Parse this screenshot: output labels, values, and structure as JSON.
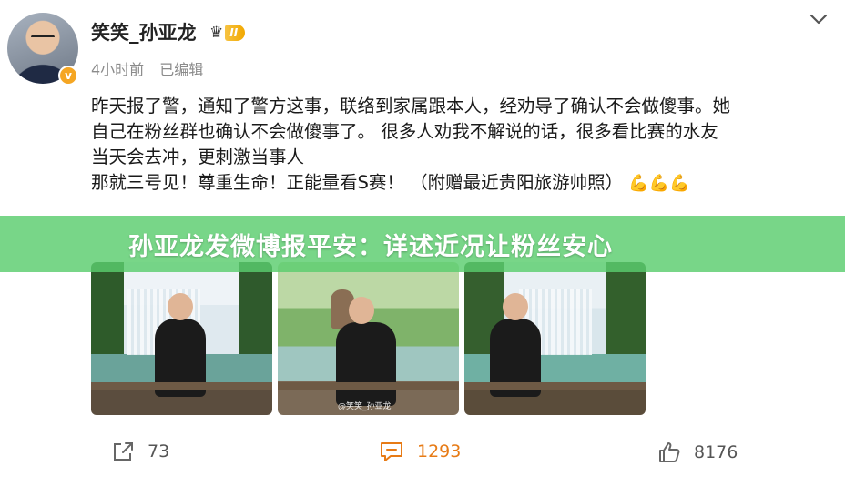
{
  "user": {
    "name": "笑笑_孙亚龙",
    "level_badge": "II",
    "verified_mark": "v"
  },
  "meta": {
    "time": "4小时前",
    "edited": "已编辑"
  },
  "post": {
    "lines": [
      "昨天报了警，通知了警方这事，联络到家属跟本人，经劝导了确认不会做傻事。她",
      "自己在粉丝群也确认不会做傻事了。 很多人劝我不解说的话，很多看比赛的水友",
      "当天会去冲，更刺激当事人",
      "那就三号见！尊重生命！正能量看S赛！  （附赠最近贵阳旅游帅照）"
    ],
    "emojis": "💪💪💪"
  },
  "photos": {
    "watermark": "@笑笑_孙亚龙"
  },
  "banner": {
    "title": "孙亚龙发微博报平安：详述近况让粉丝安心",
    "color": "#5acd6e"
  },
  "actions": {
    "share_count": "73",
    "comment_count": "1293",
    "like_count": "8176",
    "comment_color": "#e77b16"
  },
  "icons": [
    "chevron-down-icon",
    "share-icon",
    "comment-icon",
    "like-icon",
    "crown-icon"
  ]
}
